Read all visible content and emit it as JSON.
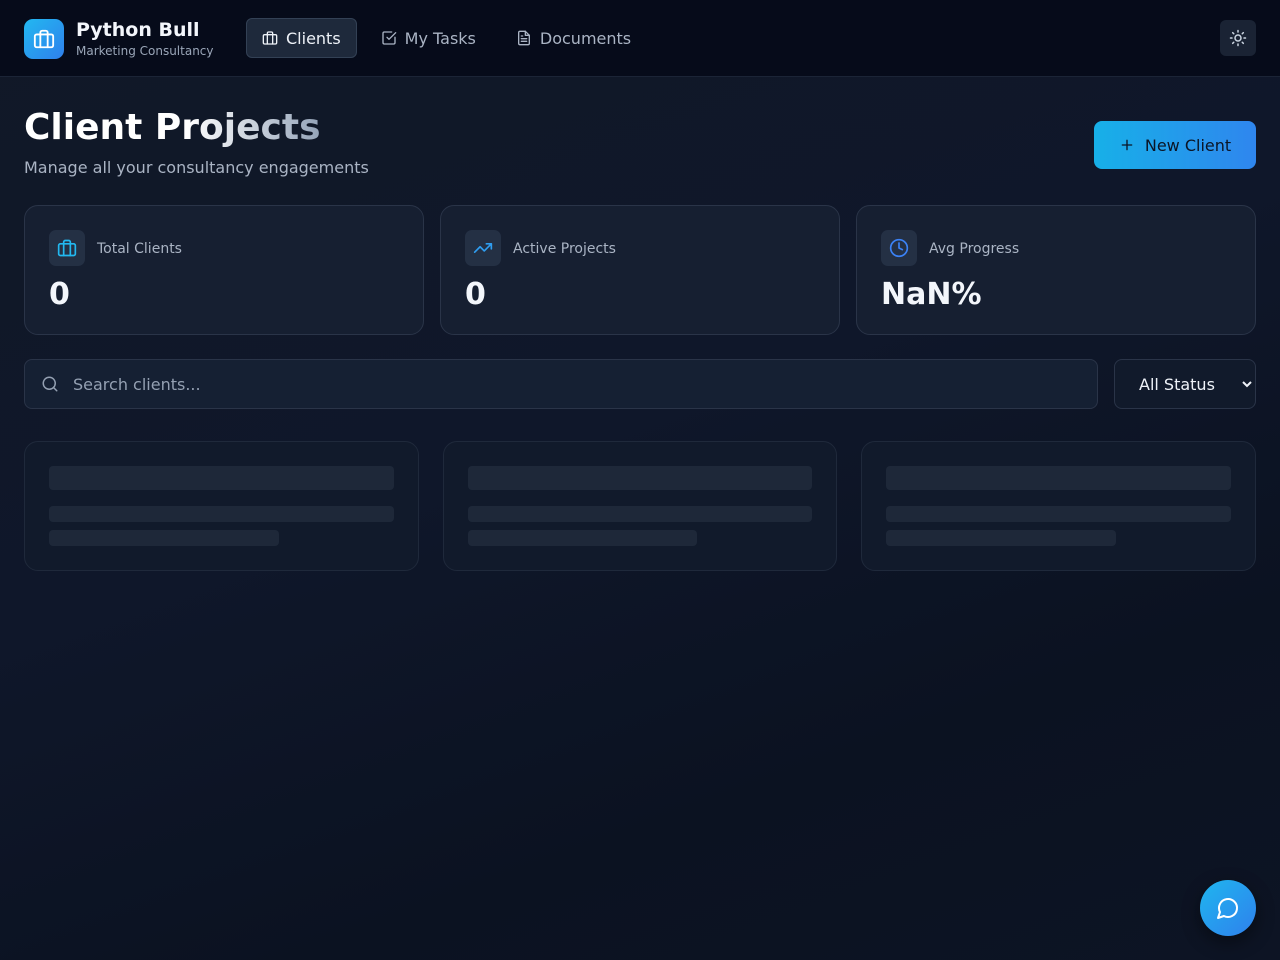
{
  "brand": {
    "name": "Python Bull",
    "subtitle": "Marketing Consultancy",
    "logo_icon": "briefcase-icon"
  },
  "nav": [
    {
      "label": "Clients",
      "icon": "briefcase-icon",
      "active": true
    },
    {
      "label": "My Tasks",
      "icon": "square-check-icon",
      "active": false
    },
    {
      "label": "Documents",
      "icon": "file-text-icon",
      "active": false
    }
  ],
  "theme_toggle": {
    "icon": "sun-icon"
  },
  "header": {
    "title": "Client Projects",
    "subtitle": "Manage all your consultancy engagements"
  },
  "new_client_button": {
    "label": "New Client",
    "icon": "plus-icon"
  },
  "stats": [
    {
      "label": "Total Clients",
      "value": "0",
      "icon": "briefcase-icon"
    },
    {
      "label": "Active Projects",
      "value": "0",
      "icon": "trending-up-icon"
    },
    {
      "label": "Avg Progress",
      "value": "NaN%",
      "icon": "clock-icon"
    }
  ],
  "search": {
    "placeholder": "Search clients...",
    "value": ""
  },
  "status_filter": {
    "selected": "All Status"
  },
  "skeleton_cards": 3,
  "chat_button": {
    "icon": "message-circle-icon"
  },
  "colors": {
    "accent": "#1fb6ee",
    "accent_end": "#2f80ed",
    "background": "#0f172a",
    "card": "#161f31",
    "topbar": "#060b1a"
  }
}
